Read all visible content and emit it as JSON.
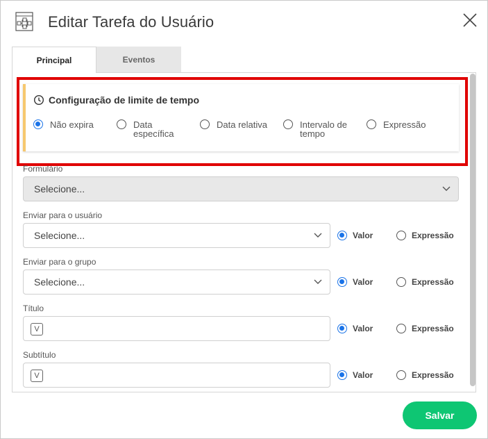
{
  "dialog": {
    "title": "Editar Tarefa do Usuário"
  },
  "tabs": [
    {
      "label": "Principal"
    },
    {
      "label": "Eventos"
    }
  ],
  "timeLimit": {
    "title": "Configuração de limite de tempo",
    "options": [
      {
        "line1": "Não expira",
        "line2": "",
        "selected": true
      },
      {
        "line1": "Data",
        "line2": "específica",
        "selected": false
      },
      {
        "line1": "Data relativa",
        "line2": "",
        "selected": false
      },
      {
        "line1": "Intervalo de",
        "line2": "tempo",
        "selected": false
      },
      {
        "line1": "Expressão",
        "line2": "",
        "selected": false
      }
    ]
  },
  "form": {
    "formulario": {
      "label": "Formulário",
      "placeholder": "Selecione..."
    },
    "usuario": {
      "label": "Enviar para o usuário",
      "placeholder": "Selecione..."
    },
    "grupo": {
      "label": "Enviar para o grupo",
      "placeholder": "Selecione..."
    },
    "titulo": {
      "label": "Título",
      "badge": "V"
    },
    "subtitulo": {
      "label": "Subtítulo",
      "badge": "V"
    },
    "modeValor": "Valor",
    "modeExpressao": "Expressão"
  },
  "actions": {
    "save": "Salvar"
  },
  "colors": {
    "accent": "#1a73e8",
    "save": "#0ec673",
    "highlight": "#e00000",
    "cardStripe": "#f6c86f"
  }
}
